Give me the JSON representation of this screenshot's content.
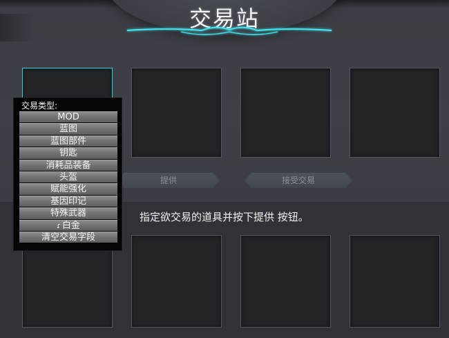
{
  "screen": {
    "title": "交易站",
    "instruction": "指定欲交易的道具并按下提供 按钮。"
  },
  "buttons": {
    "offer_label": "提供",
    "accept_label": "接受交易"
  },
  "slots": {
    "top_count": 4,
    "bottom_count": 4,
    "selected_index": 0
  },
  "dropdown": {
    "header": "交易类型:",
    "items": [
      {
        "label": "MOD"
      },
      {
        "label": "蓝图"
      },
      {
        "label": "蓝图部件"
      },
      {
        "label": "钥匙"
      },
      {
        "label": "消耗品装备"
      },
      {
        "label": "头盔"
      },
      {
        "label": "赋能强化"
      },
      {
        "label": "基因印记"
      },
      {
        "label": "特殊武器"
      },
      {
        "label": "白金",
        "icon": "platinum-icon"
      },
      {
        "label": "清空交易字段"
      }
    ]
  },
  "colors": {
    "accent_cyan": "#27d3e3",
    "panel_dark": "#222427",
    "background": "#3a3d42"
  }
}
